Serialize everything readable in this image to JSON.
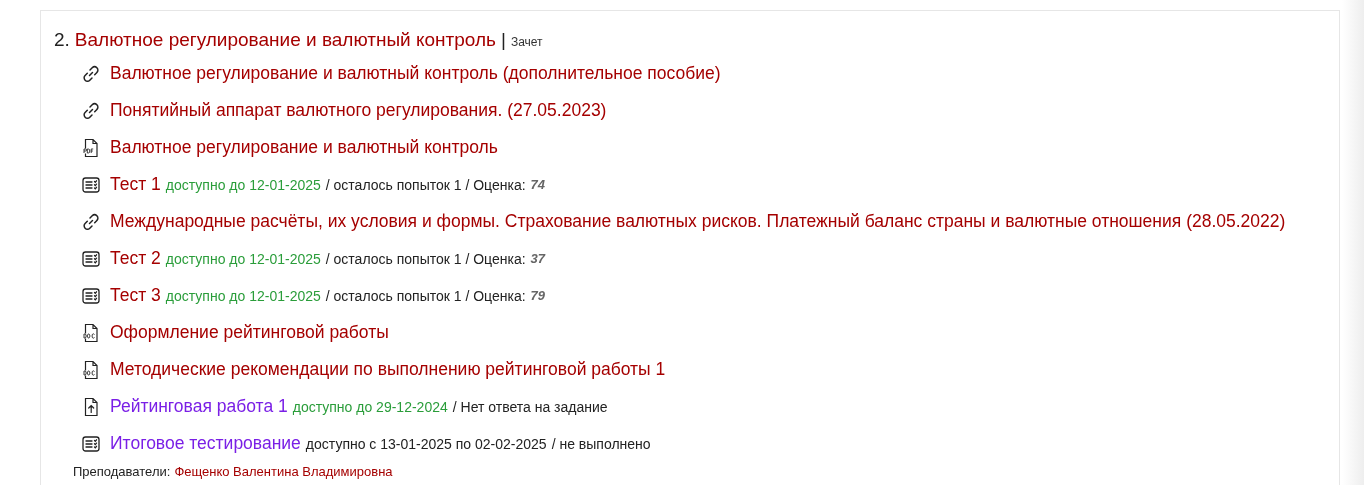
{
  "section": {
    "number": "2.",
    "title": "Валютное регулирование и валютный контроль",
    "separator": "|",
    "assessment": "Зачет"
  },
  "items": [
    {
      "kind": "link",
      "title": "Валютное регулирование и валютный контроль (дополнительное пособие)",
      "visited": true
    },
    {
      "kind": "link",
      "title": "Понятийный аппарат валютного регулирования. (27.05.2023)",
      "visited": true
    },
    {
      "kind": "pdf",
      "title": "Валютное регулирование и валютный контроль",
      "visited": true
    },
    {
      "kind": "test",
      "title": "Тест 1",
      "visited": true,
      "availability": "доступно до 12-01-2025",
      "open": true,
      "status": "/ осталось попыток 1 / Оценка:",
      "grade": "74"
    },
    {
      "kind": "link",
      "title": "Международные расчёты, их условия и формы. Страхование валютных рисков. Платежный баланс страны и валютные отношения (28.05.2022)",
      "visited": true
    },
    {
      "kind": "test",
      "title": "Тест 2",
      "visited": true,
      "availability": "доступно до 12-01-2025",
      "open": true,
      "status": "/ осталось попыток 1 / Оценка:",
      "grade": "37"
    },
    {
      "kind": "test",
      "title": "Тест 3",
      "visited": true,
      "availability": "доступно до 12-01-2025",
      "open": true,
      "status": "/ осталось попыток 1 / Оценка:",
      "grade": "79"
    },
    {
      "kind": "doc",
      "title": "Оформление рейтинговой работы",
      "visited": true
    },
    {
      "kind": "doc",
      "title": "Методические рекомендации по выполнению рейтинговой работы 1",
      "visited": true
    },
    {
      "kind": "upload",
      "title": "Рейтинговая работа 1",
      "visited": false,
      "availability": "доступно до 29-12-2024",
      "open": true,
      "status": "/ Нет ответа на задание"
    },
    {
      "kind": "test",
      "title": "Итоговое тестирование",
      "visited": false,
      "availability": "доступно с 13-01-2025 по 02-02-2025",
      "open": false,
      "status": "/ не выполнено"
    }
  ],
  "teachers": {
    "label": "Преподаватели:",
    "name": "Фещенко Валентина Владимировна"
  }
}
